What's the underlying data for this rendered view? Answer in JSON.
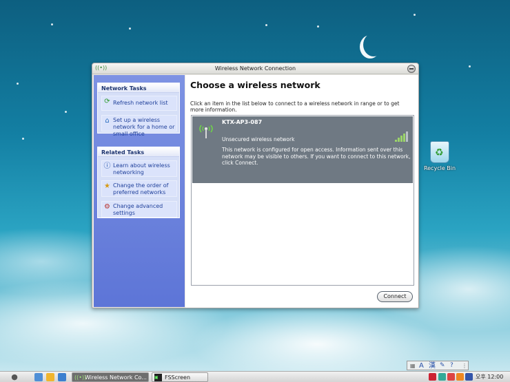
{
  "window": {
    "title": "Wireless Network Connection"
  },
  "network_tasks": {
    "header": "Network Tasks",
    "items": [
      {
        "label": "Refresh network list",
        "icon": "refresh-icon"
      },
      {
        "label": "Set up a wireless network for a home or small office",
        "icon": "setup-network-icon"
      }
    ]
  },
  "related_tasks": {
    "header": "Related Tasks",
    "items": [
      {
        "label": "Learn about wireless networking",
        "icon": "info-icon"
      },
      {
        "label": "Change the order of preferred networks",
        "icon": "star-icon"
      },
      {
        "label": "Change advanced settings",
        "icon": "settings-icon"
      }
    ]
  },
  "main": {
    "heading": "Choose a wireless network",
    "instructions": "Click an item in the list below to connect to a wireless network in range or to get more information.",
    "networks": [
      {
        "name": "KTX-AP3-087",
        "status": "Unsecured wireless network",
        "description": "This network is configured for open access. Information sent over this network may be visible to others. If you want to connect to this network, click Connect.",
        "signal_bars": 4,
        "signal_max": 5
      }
    ],
    "connect_label": "Connect"
  },
  "desktop": {
    "recycle_bin_label": "Recycle Bin"
  },
  "taskbar": {
    "buttons": [
      {
        "label": "Wireless Network Co...",
        "active": true
      },
      {
        "label": "FSScreen",
        "active": false
      }
    ],
    "clock": "오후 12:00"
  },
  "ime": {
    "label_a": "A",
    "label_hanja": "漢"
  },
  "colors": {
    "left_pane": "#6a80dc",
    "selected_network": "#6f7983",
    "task_link": "#1e3f9a"
  }
}
